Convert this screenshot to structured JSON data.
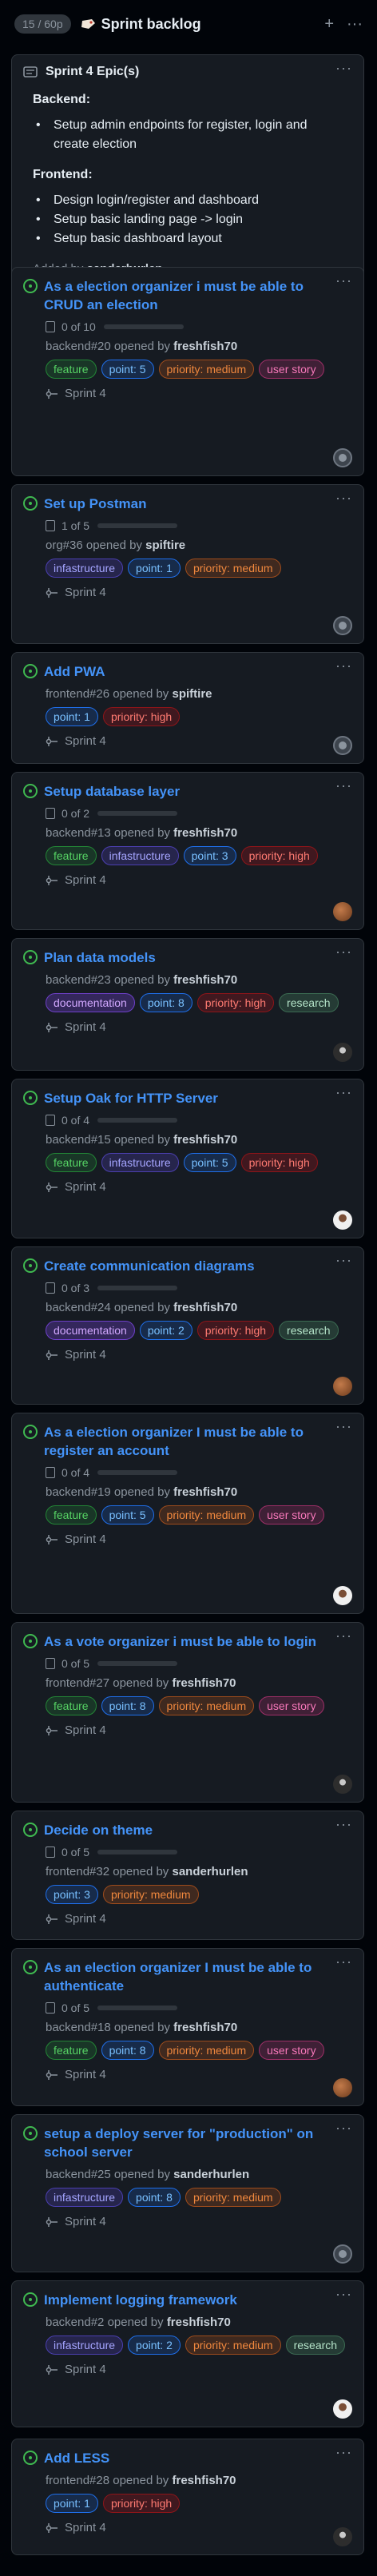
{
  "column": {
    "count": "15 / 60p",
    "title": "Sprint backlog",
    "add_symbol": "+",
    "menu_symbol": "···"
  },
  "epic": {
    "title": "Sprint 4 Epic(s)",
    "backend_heading": "Backend:",
    "backend_items": [
      "Setup admin endpoints for register, login and create election"
    ],
    "frontend_heading": "Frontend:",
    "frontend_items": [
      "Design login/register and dashboard",
      "Setup basic landing page -> login",
      "Setup basic dashboard layout"
    ],
    "added_by_prefix": "Added by",
    "added_by_user": "sanderhurlen"
  },
  "cards": [
    {
      "title": "As a election organizer i must be able to CRUD an election",
      "subtasks": "0 of 10",
      "ref": "backend#20 opened by",
      "user": "freshfish70",
      "labels": [
        {
          "text": "feature",
          "kind": "feature"
        },
        {
          "text": "point: 5",
          "kind": "point"
        },
        {
          "text": "priority: medium",
          "kind": "medium"
        },
        {
          "text": "user story",
          "kind": "story"
        }
      ],
      "sprint": "Sprint 4",
      "avatar": "gh"
    },
    {
      "title": "Set up Postman",
      "subtasks": "1 of 5",
      "ref": "org#36 opened by",
      "user": "spiftire",
      "labels": [
        {
          "text": "infastructure",
          "kind": "infra"
        },
        {
          "text": "point: 1",
          "kind": "point"
        },
        {
          "text": "priority: medium",
          "kind": "medium"
        }
      ],
      "sprint": "Sprint 4",
      "avatar": "gh"
    },
    {
      "title": "Add PWA",
      "subtasks": "",
      "ref": "frontend#26 opened by",
      "user": "spiftire",
      "labels": [
        {
          "text": "point: 1",
          "kind": "point"
        },
        {
          "text": "priority: high",
          "kind": "high"
        }
      ],
      "sprint": "Sprint 4",
      "avatar": "gh"
    },
    {
      "title": "Setup database layer",
      "subtasks": "0 of 2",
      "ref": "backend#13 opened by",
      "user": "freshfish70",
      "labels": [
        {
          "text": "feature",
          "kind": "feature"
        },
        {
          "text": "infastructure",
          "kind": "infra"
        },
        {
          "text": "point: 3",
          "kind": "point"
        },
        {
          "text": "priority: high",
          "kind": "high"
        }
      ],
      "sprint": "Sprint 4",
      "avatar": "brown"
    },
    {
      "title": "Plan data models",
      "subtasks": "",
      "ref": "backend#23 opened by",
      "user": "freshfish70",
      "labels": [
        {
          "text": "documentation",
          "kind": "doc"
        },
        {
          "text": "point: 8",
          "kind": "point"
        },
        {
          "text": "priority: high",
          "kind": "high"
        },
        {
          "text": "research",
          "kind": "research"
        }
      ],
      "sprint": "Sprint 4",
      "avatar": "dark"
    },
    {
      "title": "Setup Oak for HTTP Server",
      "subtasks": "0 of 4",
      "ref": "backend#15 opened by",
      "user": "freshfish70",
      "labels": [
        {
          "text": "feature",
          "kind": "feature"
        },
        {
          "text": "infastructure",
          "kind": "infra"
        },
        {
          "text": "point: 5",
          "kind": "point"
        },
        {
          "text": "priority: high",
          "kind": "high"
        }
      ],
      "sprint": "Sprint 4",
      "avatar": "light"
    },
    {
      "title": "Create communication diagrams",
      "subtasks": "0 of 3",
      "ref": "backend#24 opened by",
      "user": "freshfish70",
      "labels": [
        {
          "text": "documentation",
          "kind": "doc"
        },
        {
          "text": "point: 2",
          "kind": "point"
        },
        {
          "text": "priority: high",
          "kind": "high"
        },
        {
          "text": "research",
          "kind": "research"
        }
      ],
      "sprint": "Sprint 4",
      "avatar": "brown"
    },
    {
      "title": "As a election organizer I must be able to register an account",
      "subtasks": "0 of 4",
      "ref": "backend#19 opened by",
      "user": "freshfish70",
      "labels": [
        {
          "text": "feature",
          "kind": "feature"
        },
        {
          "text": "point: 5",
          "kind": "point"
        },
        {
          "text": "priority: medium",
          "kind": "medium"
        },
        {
          "text": "user story",
          "kind": "story"
        }
      ],
      "sprint": "Sprint 4",
      "avatar": "light"
    },
    {
      "title": "As a vote organizer i must be able to login",
      "subtasks": "0 of 5",
      "ref": "frontend#27 opened by",
      "user": "freshfish70",
      "labels": [
        {
          "text": "feature",
          "kind": "feature"
        },
        {
          "text": "point: 8",
          "kind": "point"
        },
        {
          "text": "priority: medium",
          "kind": "medium"
        },
        {
          "text": "user story",
          "kind": "story"
        }
      ],
      "sprint": "Sprint 4",
      "avatar": "dark"
    },
    {
      "title": "Decide on theme",
      "subtasks": "0 of 5",
      "ref": "frontend#32 opened by",
      "user": "sanderhurlen",
      "labels": [
        {
          "text": "point: 3",
          "kind": "point"
        },
        {
          "text": "priority: medium",
          "kind": "medium"
        }
      ],
      "sprint": "Sprint 4",
      "avatar": ""
    },
    {
      "title": "As an election organizer I must be able to authenticate",
      "subtasks": "0 of 5",
      "ref": "backend#18 opened by",
      "user": "freshfish70",
      "labels": [
        {
          "text": "feature",
          "kind": "feature"
        },
        {
          "text": "point: 8",
          "kind": "point"
        },
        {
          "text": "priority: medium",
          "kind": "medium"
        },
        {
          "text": "user story",
          "kind": "story"
        }
      ],
      "sprint": "Sprint 4",
      "avatar": "brown"
    },
    {
      "title": "setup a deploy server for \"production\" on school server",
      "subtasks": "",
      "ref": "backend#25 opened by",
      "user": "sanderhurlen",
      "labels": [
        {
          "text": "infastructure",
          "kind": "infra"
        },
        {
          "text": "point: 8",
          "kind": "point"
        },
        {
          "text": "priority: medium",
          "kind": "medium"
        }
      ],
      "sprint": "Sprint 4",
      "avatar": "gh"
    },
    {
      "title": "Implement logging framework",
      "subtasks": "",
      "ref": "backend#2 opened by",
      "user": "freshfish70",
      "labels": [
        {
          "text": "infastructure",
          "kind": "infra"
        },
        {
          "text": "point: 2",
          "kind": "point"
        },
        {
          "text": "priority: medium",
          "kind": "medium"
        },
        {
          "text": "research",
          "kind": "research"
        }
      ],
      "sprint": "Sprint 4",
      "avatar": "light"
    },
    {
      "title": "Add LESS",
      "subtasks": "",
      "ref": "frontend#28 opened by",
      "user": "freshfish70",
      "labels": [
        {
          "text": "point: 1",
          "kind": "point"
        },
        {
          "text": "priority: high",
          "kind": "high"
        }
      ],
      "sprint": "Sprint 4",
      "avatar": "dark"
    }
  ]
}
